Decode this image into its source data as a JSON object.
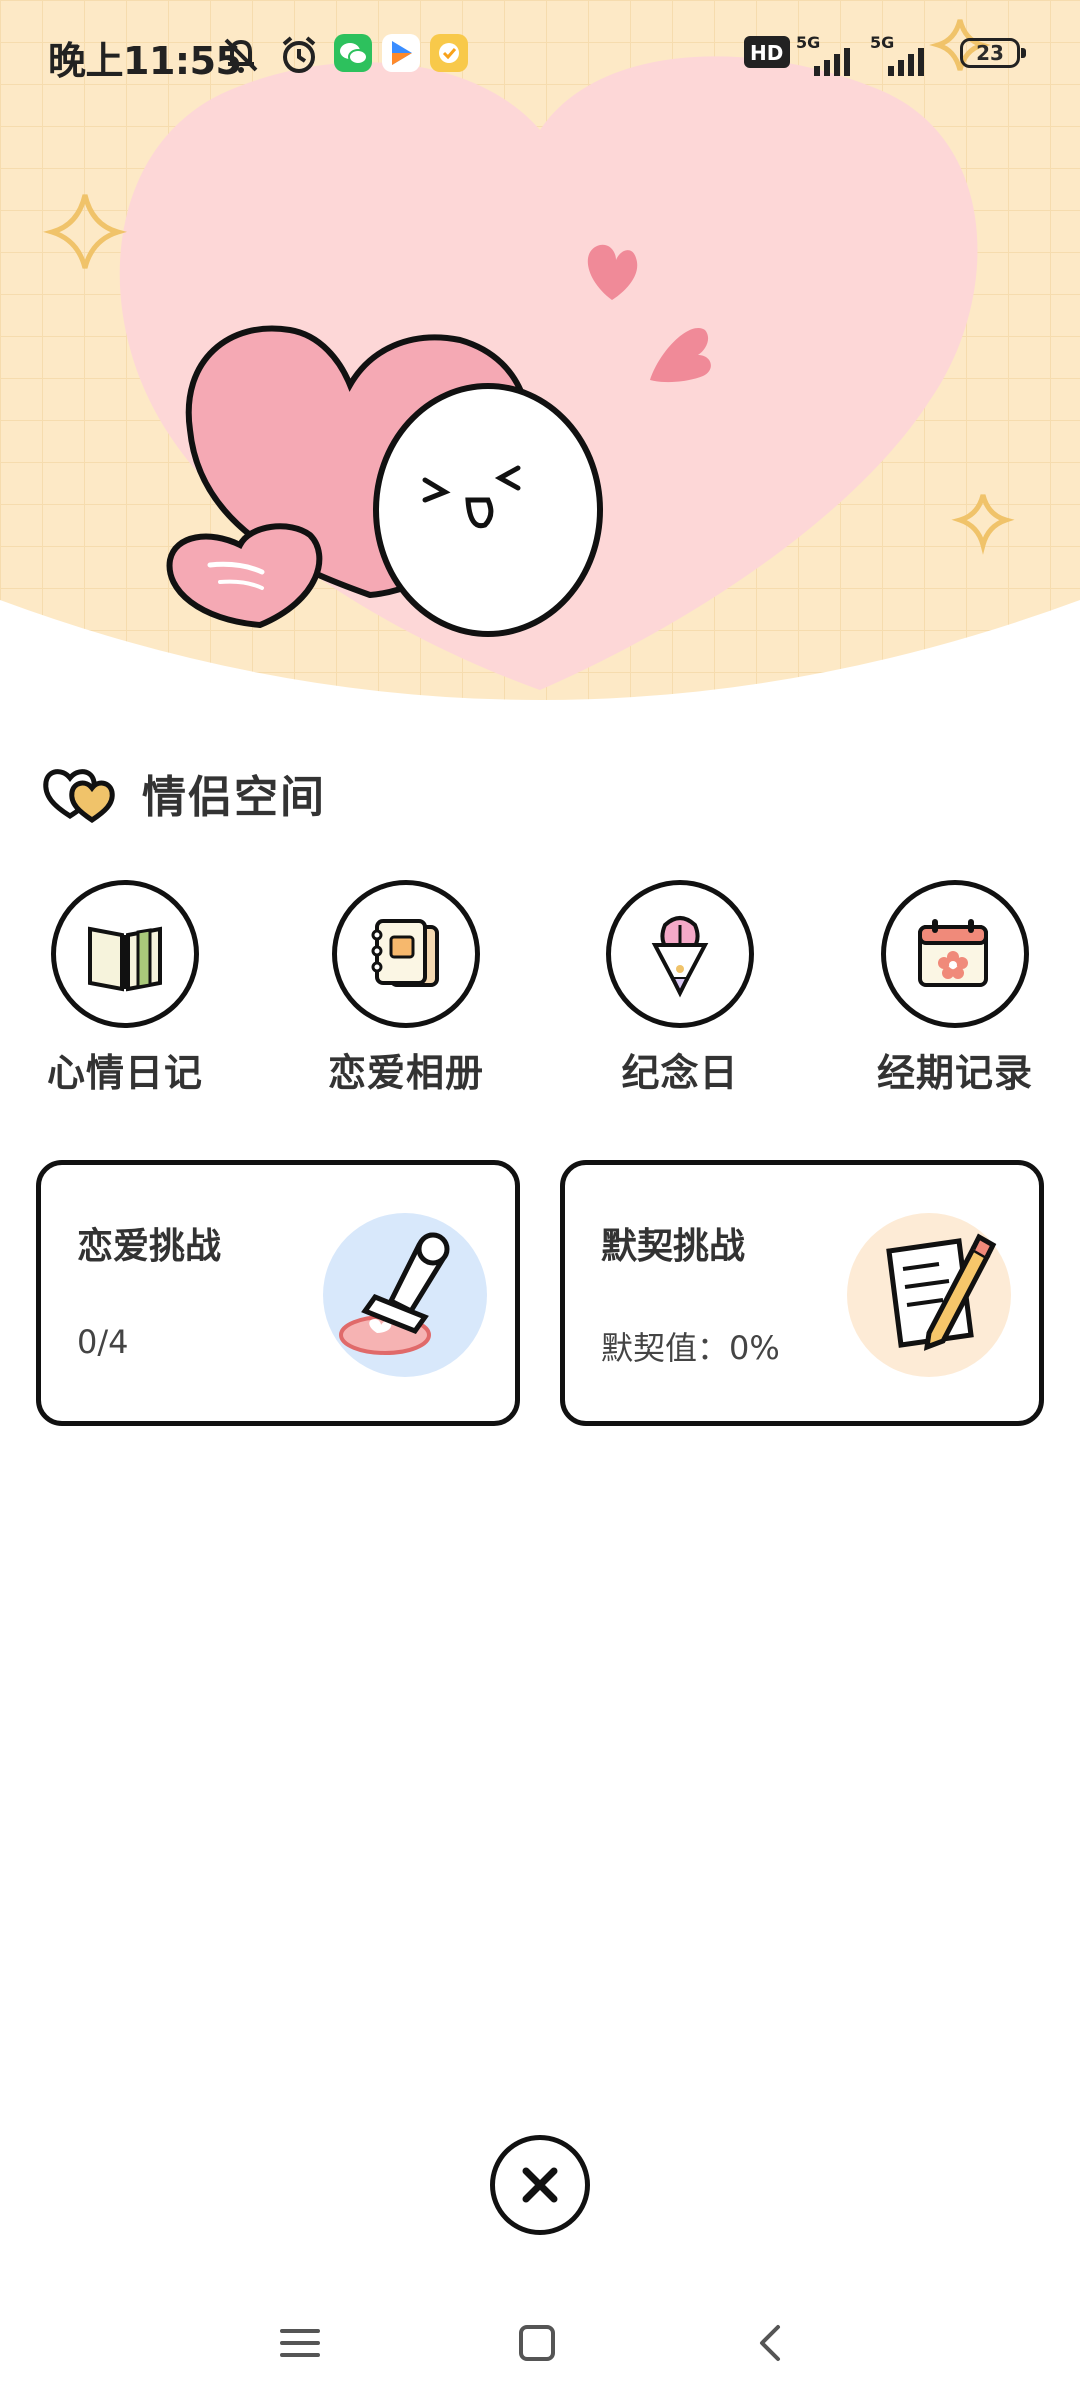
{
  "status_bar": {
    "time": "晚上11:55",
    "battery": "23",
    "network_left": "5G",
    "network_right": "5G",
    "hd_label": "HD"
  },
  "section": {
    "title": "情侣空间",
    "icon": "double-heart-icon"
  },
  "features": [
    {
      "label": "心情日记",
      "icon": "diary-book-icon"
    },
    {
      "label": "恋爱相册",
      "icon": "photo-album-icon"
    },
    {
      "label": "纪念日",
      "icon": "flower-bouquet-icon"
    },
    {
      "label": "经期记录",
      "icon": "calendar-flower-icon"
    }
  ],
  "cards": [
    {
      "title": "恋爱挑战",
      "subtitle": "0/4",
      "icon": "stamp-icon"
    },
    {
      "title": "默契挑战",
      "subtitle": "默契值：0%",
      "icon": "notepad-pencil-icon"
    }
  ],
  "colors": {
    "hero_bg": "#fde9c6",
    "hero_heart": "#fdd7d7",
    "heart_pink": "#f5a9b4",
    "accent_gold": "#f0c36a",
    "border": "#111111"
  }
}
